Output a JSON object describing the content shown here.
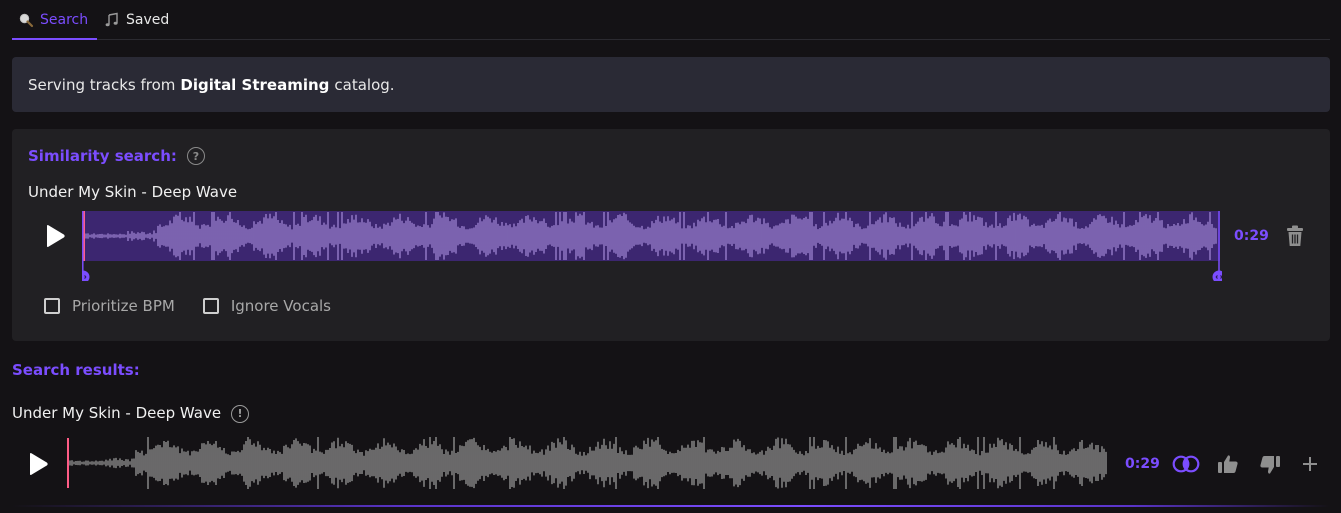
{
  "tabs": [
    {
      "label": "Search",
      "icon": "magnifier-icon",
      "active": true
    },
    {
      "label": "Saved",
      "icon": "music-notes-icon",
      "active": false
    }
  ],
  "banner": {
    "prefix": "Serving tracks from",
    "catalog": "Digital Streaming",
    "suffix": "catalog."
  },
  "similarity": {
    "title": "Similarity search:",
    "help_symbol": "?",
    "track_title": "Under My Skin - Deep Wave",
    "time": "0:29",
    "options": [
      {
        "label": "Prioritize BPM",
        "checked": false
      },
      {
        "label": "Ignore Vocals",
        "checked": false
      }
    ]
  },
  "results": {
    "title": "Search results:",
    "items": [
      {
        "title": "Under My Skin - Deep Wave",
        "warn_symbol": "!",
        "time": "0:29"
      }
    ]
  },
  "colors": {
    "accent": "#7b4dff",
    "background": "#141215",
    "panel": "#212023",
    "banner": "#2a2a35",
    "waveform_selected": "#8b72bf",
    "waveform_result": "#7f7f7f",
    "playhead": "#ff5c86"
  }
}
